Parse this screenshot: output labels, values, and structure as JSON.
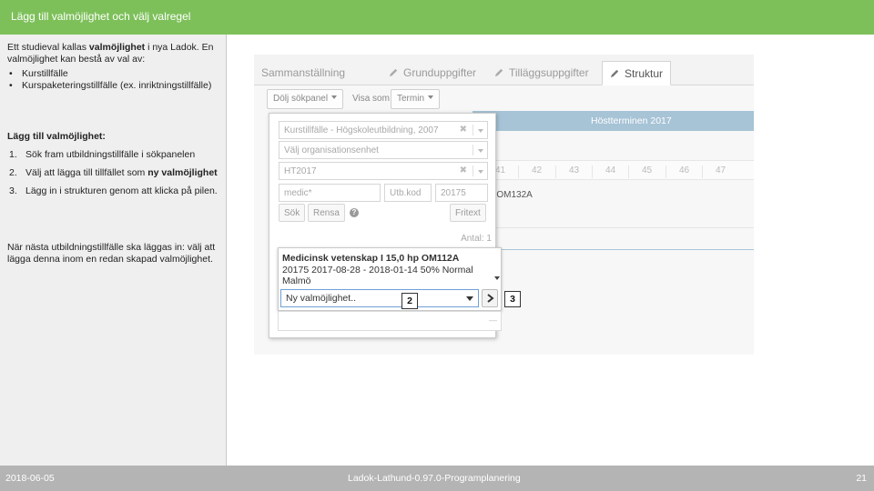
{
  "title": "Lägg till valmöjlighet och välj valregel",
  "left_panel": {
    "intro_prefix": "Ett studieval kallas ",
    "intro_bold": "valmöjlighet",
    "intro_suffix": " i nya Ladok. En valmöjlighet kan bestå av val av:",
    "bullets": [
      "Kurstillfälle",
      "Kurspaketeringstillfälle (ex. inriktningstillfälle)"
    ],
    "heading": "Lägg till valmöjlighet:",
    "steps": [
      {
        "num": "1.",
        "text": "Sök fram utbildningstillfälle i sökpanelen",
        "bold": ""
      },
      {
        "num": "2.",
        "text": "Välj att lägga till tillfället som ",
        "bold": "ny valmöjlighet"
      },
      {
        "num": "3.",
        "text": "Lägg in i strukturen genom att klicka på pilen.",
        "bold": ""
      }
    ],
    "note": "När nästa utbildningstillfälle ska läggas in: välj att lägga denna inom en redan skapad valmöjlighet."
  },
  "footer": {
    "date": "2018-06-05",
    "doc": "Ladok-Lathund-0.97.0-Programplanering",
    "page": "21"
  },
  "screenshot": {
    "tabs": [
      {
        "label": "Sammanställning",
        "icon": ""
      },
      {
        "label": "Grunduppgifter",
        "icon": "pencil-icon"
      },
      {
        "label": "Tilläggsuppgifter",
        "icon": "pencil-icon"
      },
      {
        "label": "Struktur",
        "icon": "pencil-icon"
      }
    ],
    "toolbar": {
      "hide_panel": "Dölj sökpanel",
      "show_as": "Visa som",
      "term": "Termin"
    },
    "term_label": "Höstterminen 2017",
    "weeks": [
      "41",
      "42",
      "43",
      "44",
      "45",
      "46",
      "47"
    ],
    "course_ref": "p OM132A",
    "search": {
      "type": "Kurstillfälle - Högskoleutbildning, 2007",
      "org_placeholder": "Välj organisationsenhet",
      "term": "HT2017",
      "name": "medic*",
      "utb_kod_placeholder": "Utb.kod",
      "code": "20175",
      "search_btn": "Sök",
      "clear_btn": "Rensa",
      "help": "?",
      "free_text_btn": "Fritext",
      "antal": "Antal: 1"
    },
    "result": {
      "name": "Medicinsk vetenskap I 15,0 hp OM112A",
      "info": "20175 2017-08-28 - 2018-01-14 50% Normal Malmö"
    },
    "select_value": "Ny valmöjlighet..",
    "callouts": [
      "2",
      "3"
    ]
  },
  "colors": {
    "title_bar": "#7dc05a",
    "footer": "#b4b4b4",
    "term_band": "#a7c3d6"
  }
}
